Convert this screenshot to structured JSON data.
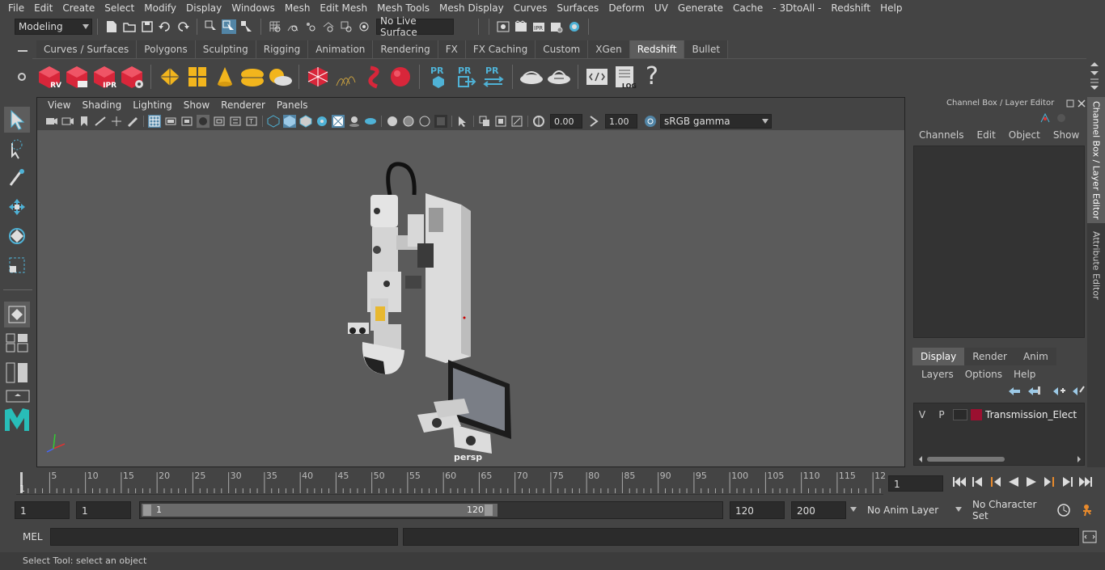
{
  "menubar": [
    "File",
    "Edit",
    "Create",
    "Select",
    "Modify",
    "Display",
    "Windows",
    "Mesh",
    "Edit Mesh",
    "Mesh Tools",
    "Mesh Display",
    "Curves",
    "Surfaces",
    "Deform",
    "UV",
    "Generate",
    "Cache",
    "- 3DtoAll -",
    "Redshift",
    "Help"
  ],
  "statusline": {
    "mode": "Modeling",
    "live_surface": "No Live Surface"
  },
  "shelf_tabs": [
    "Curves / Surfaces",
    "Polygons",
    "Sculpting",
    "Rigging",
    "Animation",
    "Rendering",
    "FX",
    "FX Caching",
    "Custom",
    "XGen",
    "Redshift",
    "Bullet"
  ],
  "shelf_active": "Redshift",
  "shelf_labels": {
    "rv": "RV",
    "ipr": "IPR",
    "pr1": "PR",
    "pr2": "PR",
    "pr3": "PR",
    "log": "LOG",
    "help": "?"
  },
  "viewport": {
    "menu": [
      "View",
      "Shading",
      "Lighting",
      "Show",
      "Renderer",
      "Panels"
    ],
    "exposure": "0.00",
    "gamma": "1.00",
    "colorspace": "sRGB gamma",
    "camera_label": "persp"
  },
  "channel_box": {
    "title": "Channel Box / Layer Editor",
    "menu": [
      "Channels",
      "Edit",
      "Object",
      "Show"
    ]
  },
  "layer_editor": {
    "tabs": [
      "Display",
      "Render",
      "Anim"
    ],
    "active_tab": "Display",
    "menu": [
      "Layers",
      "Options",
      "Help"
    ],
    "layer": {
      "v": "V",
      "p": "P",
      "name": "Transmission_Electron",
      "color": "#9b1030"
    }
  },
  "side_tabs": [
    "Channel Box / Layer Editor",
    "Attribute Editor"
  ],
  "timeline": {
    "ticks": [
      "5",
      "10",
      "15",
      "20",
      "25",
      "30",
      "35",
      "40",
      "45",
      "50",
      "55",
      "60",
      "65",
      "70",
      "75",
      "80",
      "85",
      "90",
      "95",
      "100",
      "105",
      "110",
      "115",
      "12"
    ],
    "start_label": "1",
    "current_frame": "1"
  },
  "range": {
    "start": "1",
    "playback_start": "1",
    "slider_start": "1",
    "slider_end": "120",
    "playback_end": "120",
    "end": "200",
    "anim_layer": "No Anim Layer",
    "character_set": "No Character Set"
  },
  "cmdline": {
    "label": "MEL"
  },
  "helpline": {
    "text": "Select Tool: select an object"
  },
  "colors": {
    "accent": "#5d5d5d",
    "viewport_bg": "#5b5b5b",
    "redshift_red": "#d8263a",
    "gold": "#f2b51d",
    "active_tool": "#5285a6"
  }
}
